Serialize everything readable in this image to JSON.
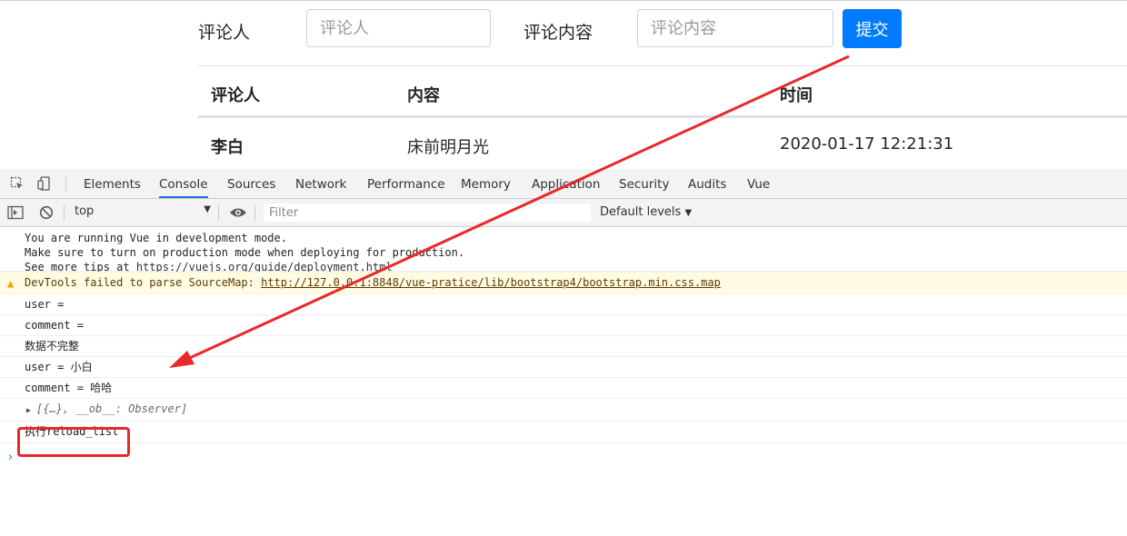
{
  "form": {
    "commenter_label": "评论人",
    "commenter_placeholder": "评论人",
    "content_label": "评论内容",
    "content_placeholder": "评论内容",
    "submit_label": "提交"
  },
  "table": {
    "headers": [
      "评论人",
      "内容",
      "时间"
    ],
    "rows": [
      {
        "user": "李白",
        "content": "床前明月光",
        "time": "2020-01-17 12:21:31"
      }
    ]
  },
  "devtools": {
    "tabs": [
      "Elements",
      "Console",
      "Sources",
      "Network",
      "Performance",
      "Memory",
      "Application",
      "Security",
      "Audits",
      "Vue"
    ],
    "active_tab": "Console",
    "context": "top",
    "filter_placeholder": "Filter",
    "levels": "Default levels",
    "messages": {
      "m1_line1": "You are running Vue in development mode.",
      "m1_line2": "Make sure to turn on production mode when deploying for production.",
      "m1_line3_prefix": "See more tips at ",
      "m1_line3_link": "https://vuejs.org/guide/deployment.html",
      "warn_prefix": "DevTools failed to parse SourceMap: ",
      "warn_link": "http://127.0.0.1:8848/vue-pratice/lib/bootstrap4/bootstrap.min.css.map",
      "m3": "user =",
      "m4": "comment =",
      "m5": "数据不完整",
      "m6": "user = 小白",
      "m7": "comment = 哈哈",
      "m8": "[{…}, __ob__: Observer]",
      "m9": "执行reload_list"
    },
    "prompt": "›"
  },
  "colors": {
    "primary": "#007bff",
    "annotation_red": "#e8282b",
    "devtools_accent": "#1a73e8",
    "warning_bg": "#fffbe5"
  }
}
